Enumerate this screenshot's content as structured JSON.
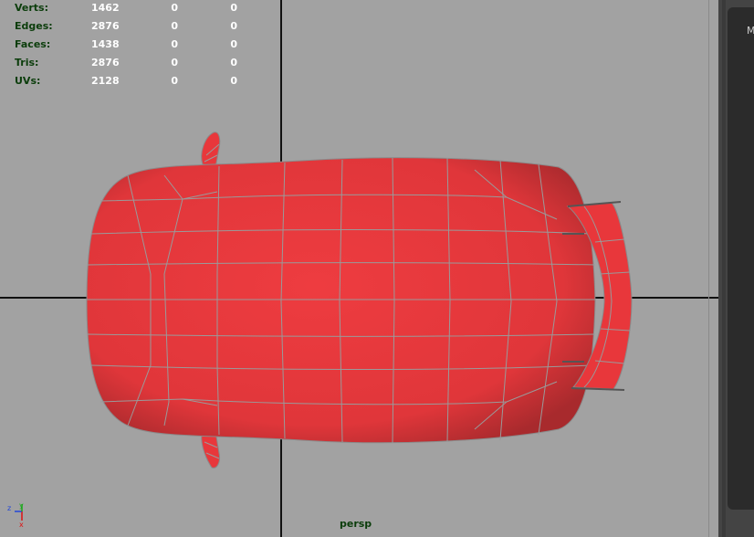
{
  "hud": {
    "rows": [
      {
        "label": "Verts:",
        "v1": "1462",
        "v2": "0",
        "v3": "0"
      },
      {
        "label": "Edges:",
        "v1": "2876",
        "v2": "0",
        "v3": "0"
      },
      {
        "label": "Faces:",
        "v1": "1438",
        "v2": "0",
        "v3": "0"
      },
      {
        "label": "Tris:",
        "v1": "2876",
        "v2": "0",
        "v3": "0"
      },
      {
        "label": "UVs:",
        "v1": "2128",
        "v2": "0",
        "v3": "0"
      }
    ]
  },
  "viewport": {
    "camera_label": "persp",
    "axis": {
      "x": "x",
      "y": "y",
      "z": "z"
    },
    "model_color": "#e8373b",
    "wire_color": "#9a9a9a",
    "background_color": "#a2a2a2"
  },
  "side_panel": {
    "label": "M"
  }
}
